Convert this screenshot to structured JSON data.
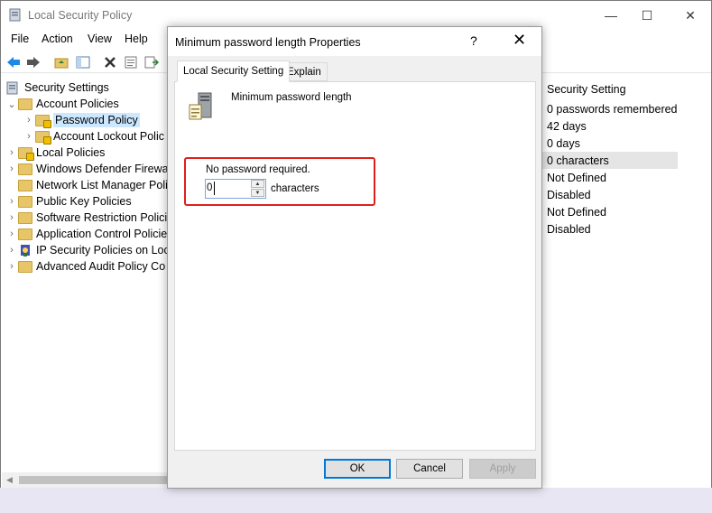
{
  "app": {
    "title": "Local Security Policy",
    "window_buttons": {
      "minimize": "—",
      "maximize": "☐",
      "close": "✕"
    }
  },
  "menu": [
    "File",
    "Action",
    "View",
    "Help"
  ],
  "toolbar_icons": [
    "back-arrow-icon",
    "forward-arrow-icon",
    "up-folder-icon",
    "show-hide-tree-icon",
    "delete-icon",
    "properties-icon",
    "export-list-icon"
  ],
  "tree": {
    "root": "Security Settings",
    "items": [
      {
        "label": "Account Policies",
        "expanded": true
      },
      {
        "label": "Password Policy",
        "selected": true
      },
      {
        "label": "Account Lockout Polic"
      },
      {
        "label": "Local Policies"
      },
      {
        "label": "Windows Defender Firewa"
      },
      {
        "label": "Network List Manager Poli"
      },
      {
        "label": "Public Key Policies"
      },
      {
        "label": "Software Restriction Policie"
      },
      {
        "label": "Application Control Policie"
      },
      {
        "label": "IP Security Policies on Loca"
      },
      {
        "label": "Advanced Audit Policy Co"
      }
    ]
  },
  "right_pane": {
    "header": "Security Setting",
    "items": [
      "0 passwords remembered",
      "42 days",
      "0 days",
      "0 characters",
      "Not Defined",
      "Disabled",
      "Not Defined",
      "Disabled"
    ]
  },
  "dialog": {
    "title": "Minimum password length Properties",
    "help_glyph": "?",
    "close_glyph": "✕",
    "tabs": [
      "Local Security Setting",
      "Explain"
    ],
    "policy_name": "Minimum password length",
    "status_text": "No password required.",
    "spin_value": "0",
    "spin_unit": "characters",
    "buttons": {
      "ok": "OK",
      "cancel": "Cancel",
      "apply": "Apply"
    }
  },
  "colors": {
    "highlight_border": "#e0201c",
    "selection": "#cce8ff",
    "ok_focus": "#0078d7"
  }
}
